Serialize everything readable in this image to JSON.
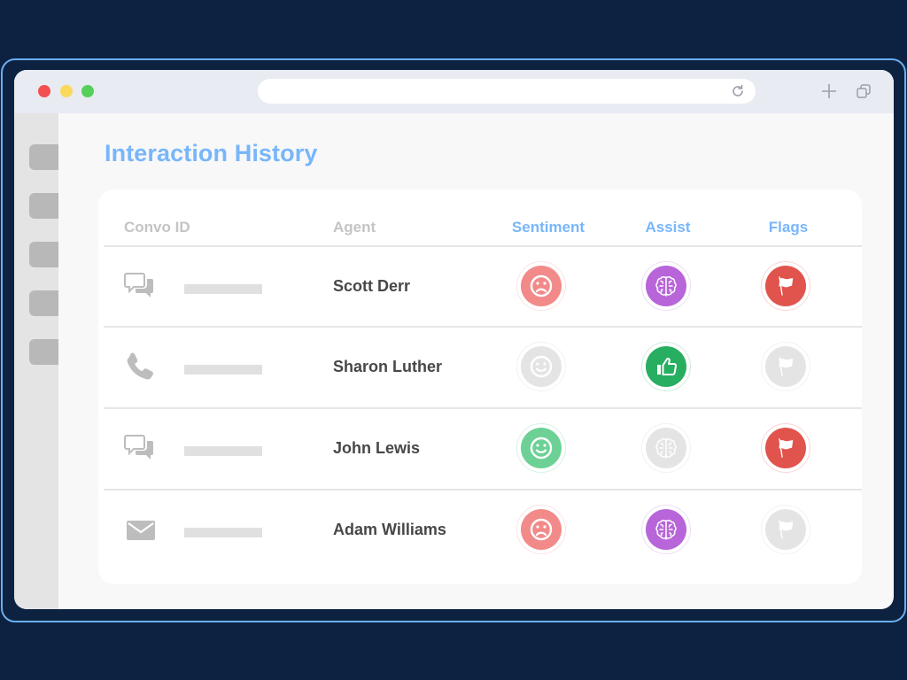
{
  "window": {
    "url": "",
    "controls": [
      "close",
      "minimize",
      "maximize"
    ],
    "toolbar_icons": [
      "reload-icon",
      "plus-icon",
      "copy-icon"
    ]
  },
  "sidebar": {
    "items": [
      {
        "name": "sidebar-item-1"
      },
      {
        "name": "sidebar-item-2"
      },
      {
        "name": "sidebar-item-3"
      },
      {
        "name": "sidebar-item-4"
      },
      {
        "name": "sidebar-item-5"
      }
    ]
  },
  "page": {
    "title": "Interaction History"
  },
  "table": {
    "headers": {
      "convo_id": "Convo ID",
      "agent": "Agent",
      "sentiment": "Sentiment",
      "assist": "Assist",
      "flags": "Flags"
    },
    "rows": [
      {
        "channel": "chat",
        "channel_icon": "chat-bubbles-icon",
        "agent": "Scott Derr",
        "sentiment": "negative",
        "sentiment_icon": "sad-face-icon",
        "assist": "ai-assist",
        "assist_icon": "brain-icon",
        "flag": "flagged",
        "flag_icon": "flag-icon"
      },
      {
        "channel": "phone",
        "channel_icon": "phone-icon",
        "agent": "Sharon Luther",
        "sentiment": "neutral-inactive",
        "sentiment_icon": "smile-face-icon",
        "assist": "approved",
        "assist_icon": "thumbs-up-icon",
        "flag": "not-flagged",
        "flag_icon": "flag-icon"
      },
      {
        "channel": "chat",
        "channel_icon": "chat-bubbles-icon",
        "agent": "John Lewis",
        "sentiment": "positive",
        "sentiment_icon": "smile-face-icon",
        "assist": "inactive",
        "assist_icon": "brain-icon",
        "flag": "flagged",
        "flag_icon": "flag-icon"
      },
      {
        "channel": "email",
        "channel_icon": "envelope-icon",
        "agent": "Adam Williams",
        "sentiment": "negative",
        "sentiment_icon": "sad-face-icon",
        "assist": "ai-assist",
        "assist_icon": "brain-icon",
        "flag": "not-flagged",
        "flag_icon": "flag-icon"
      }
    ]
  },
  "colors": {
    "background": "#0d2240",
    "frame_border": "#6aaef0",
    "accent": "#78b6fa",
    "sentiment_negative": "#f28a8a",
    "sentiment_positive": "#6dd195",
    "assist_brain": "#b765d9",
    "assist_thumbs": "#27ae60",
    "flag_red": "#e0544d",
    "inactive": "#e4e4e4"
  }
}
